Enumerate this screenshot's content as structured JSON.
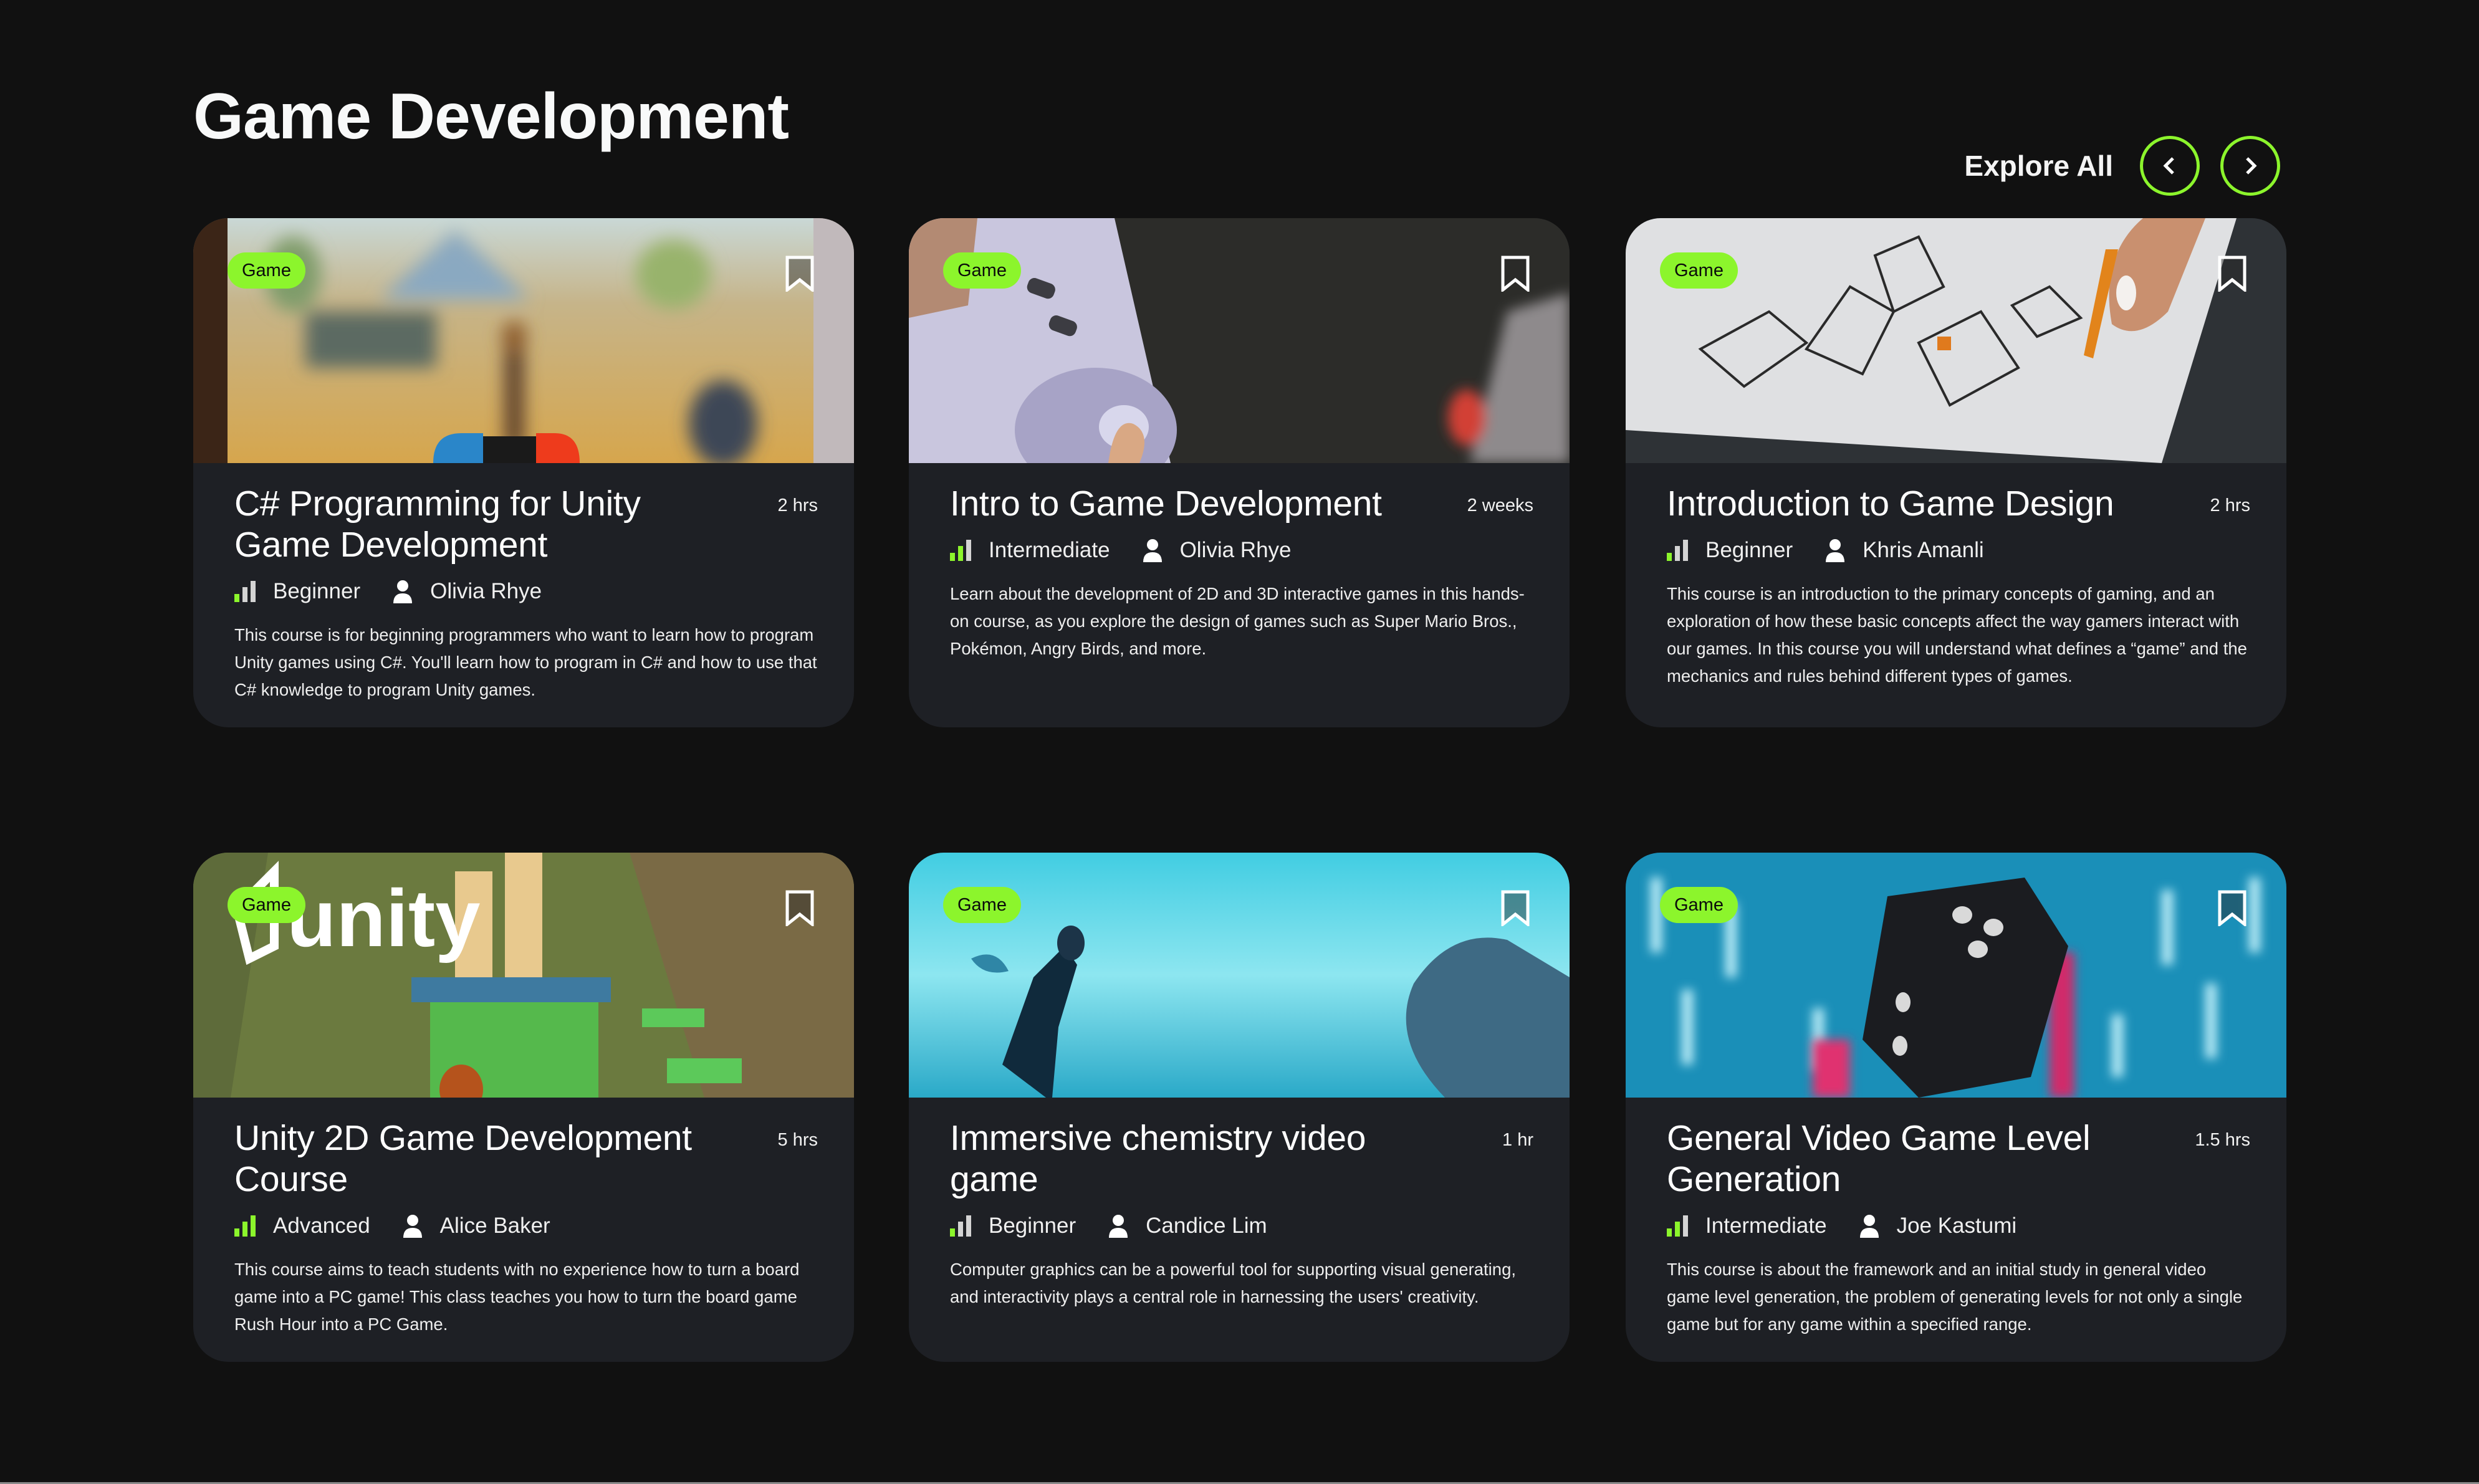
{
  "header": {
    "title": "Game Development",
    "explore_all_label": "Explore All",
    "prev_icon": "chevron-left-icon",
    "next_icon": "chevron-right-icon"
  },
  "colors": {
    "background": "#111111",
    "card": "#1e2025",
    "accent": "#8cf52c",
    "level_inactive": "#d4d4d4"
  },
  "courses": [
    {
      "tag": "Game",
      "title": "C# Programming for Unity Game Development",
      "duration": "2 hrs",
      "level": "Beginner",
      "level_bars": 1,
      "instructor": "Olivia Rhye",
      "description": "This course is for beginning programmers who want to learn how to program Unity games using C#. You'll learn how to program in C# and how to use that C# knowledge to program Unity games.",
      "image": "blurred open-world video game on a handheld console screen"
    },
    {
      "tag": "Game",
      "title": "Intro to Game Development",
      "duration": "2 weeks",
      "level": "Intermediate",
      "level_bars": 2,
      "instructor": "Olivia Rhye",
      "description": "Learn about the development of 2D and 3D interactive games in this hands-on course, as you explore the design of games such as Super Mario Bros., Pokémon, Angry Birds, and more.",
      "image": "hands holding a Super Nintendo controller"
    },
    {
      "tag": "Game",
      "title": "Introduction to Game Design",
      "duration": "2 hrs",
      "level": "Beginner",
      "level_bars": 1,
      "instructor": "Khris Amanli",
      "description": "This course is an introduction to the primary concepts of gaming, and an exploration of how these basic concepts affect the way gamers interact with our games. In this course you will understand what defines a “game” and the mechanics and rules behind different types of games.",
      "image": "hand sketching wireframes with an orange pencil"
    },
    {
      "tag": "Game",
      "title": "Unity 2D Game Development Course",
      "duration": "5 hrs",
      "level": "Advanced",
      "level_bars": 3,
      "instructor": "Alice Baker",
      "description": "This course aims to teach students with no experience how to turn a board game into a PC game! This class teaches you how to turn the board game Rush Hour into a PC Game.",
      "image": "unity logo over a blocky 3D game level"
    },
    {
      "tag": "Game",
      "title": "Immersive chemistry video game",
      "duration": "1 hr",
      "level": "Beginner",
      "level_bars": 1,
      "instructor": "Candice Lim",
      "description": "Computer graphics can be a powerful tool for supporting visual generating, and interactivity plays a central role in harnessing the users' creativity.",
      "image": "diver swimming underwater beside a whale"
    },
    {
      "tag": "Game",
      "title": "General Video Game Level Generation",
      "duration": "1.5 hrs",
      "level": "Intermediate",
      "level_bars": 2,
      "instructor": "Joe Kastumi",
      "description": "This course is about the framework and an initial study in general video game level generation, the problem of generating levels for not only a single game but for any game within a specified range.",
      "image": "black die with white pips against blurred blue lights"
    }
  ]
}
